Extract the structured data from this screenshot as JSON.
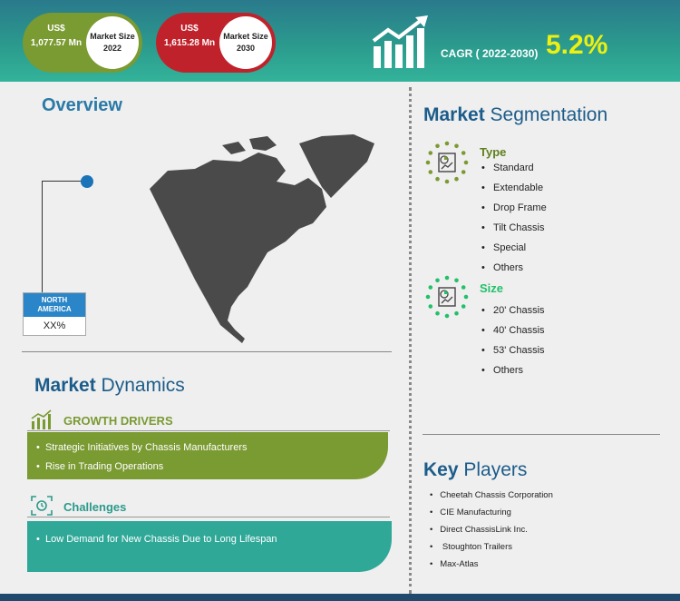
{
  "header": {
    "market_2022": {
      "value": "US$ 1,077.57 Mn",
      "label": "Market Size 2022"
    },
    "market_2030": {
      "value": "US$ 1,615.28 Mn",
      "label": "Market Size 2030"
    },
    "cagr_label": "CAGR ( 2022-2030)",
    "cagr_value": "5.2%",
    "cagr_icon": "growth-chart-icon"
  },
  "overview": {
    "title": "Overview",
    "region_label": "NORTH AMERICA",
    "region_value": "XX%",
    "map_icon": "north-america-map"
  },
  "dynamics": {
    "title_bold": "Market",
    "title_rest": "Dynamics",
    "drivers_heading": "GROWTH DRIVERS",
    "drivers": [
      "Strategic Initiatives by Chassis Manufacturers",
      "Rise in Trading Operations"
    ],
    "challenges_heading": "Challenges",
    "challenges": [
      "Low Demand for New Chassis Due to Long Lifespan"
    ]
  },
  "segmentation": {
    "title_bold": "Market",
    "title_rest": "Segmentation",
    "type_heading": "Type",
    "type_items": [
      "Standard",
      "Extendable",
      "Drop Frame",
      "Tilt Chassis",
      "Special",
      "Others"
    ],
    "size_heading": "Size",
    "size_items": [
      "20' Chassis",
      "40' Chassis",
      "53' Chassis",
      "Others"
    ]
  },
  "key_players": {
    "title_bold": "Key",
    "title_rest": "Players",
    "items": [
      "Cheetah Chassis Corporation",
      "CIE Manufacturing",
      "Direct ChassisLink Inc.",
      "Stoughton Trailers",
      "Max-Atlas"
    ]
  },
  "colors": {
    "green": "#7a9a32",
    "red": "#c0222b",
    "teal": "#2fa898",
    "blue_title": "#1c5c8a",
    "cagr_yellow": "#eef012"
  }
}
